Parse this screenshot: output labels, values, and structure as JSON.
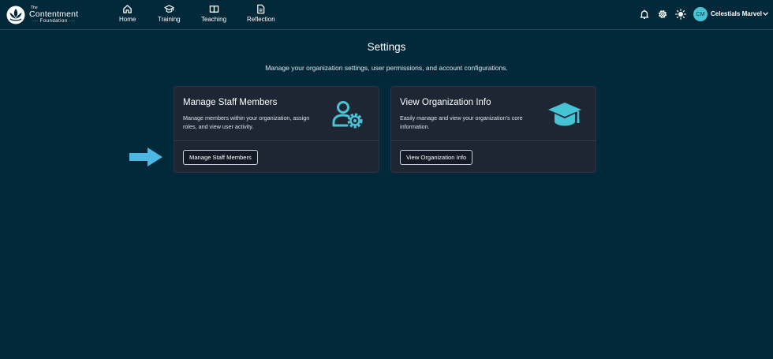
{
  "brand": {
    "the": "The",
    "name": "Contentment",
    "sub": "··· Foundation ···"
  },
  "nav": {
    "items": [
      {
        "label": "Home",
        "icon": "home-icon"
      },
      {
        "label": "Training",
        "icon": "graduation-cap-icon"
      },
      {
        "label": "Teaching",
        "icon": "book-icon"
      },
      {
        "label": "Reflection",
        "icon": "document-icon"
      }
    ]
  },
  "toolbar": {
    "icons": [
      "bell-icon",
      "gear-icon",
      "sun-icon"
    ]
  },
  "user": {
    "initials": "CM",
    "name": "Celestials Marvel"
  },
  "page": {
    "title": "Settings",
    "description": "Manage your organization settings, user permissions, and account configurations."
  },
  "cards": [
    {
      "title": "Manage Staff Members",
      "description": "Manage members within your organization, assign roles, and view user activity.",
      "button": "Manage Staff Members",
      "icon": "user-settings-icon"
    },
    {
      "title": "View Organization Info",
      "description": "Easily manage and view your organization's core information.",
      "button": "View Organization Info",
      "icon": "graduation-cap-icon"
    }
  ],
  "colors": {
    "background": "#02293a",
    "card": "#1e2533",
    "accent": "#46c3d4",
    "arrow": "#4ab8e2"
  }
}
